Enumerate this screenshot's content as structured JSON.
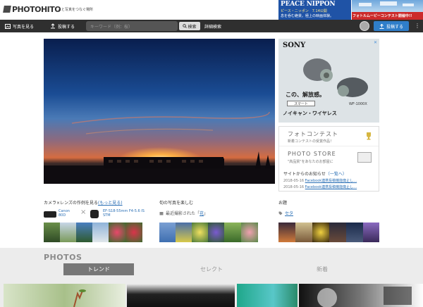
{
  "brand": {
    "logo_text": "PHOTOHITO",
    "tagline": "人と写真をつなぐ場所"
  },
  "ads": {
    "peace": {
      "title": "PEACE NIPPON",
      "line1": "ピース・ニッポン　7.14公開",
      "line2": "息を呑む絶景。極上の映画体験。"
    },
    "photo_contest": {
      "text": "フォトルムービーコンテスト開催中!!"
    },
    "sony": {
      "brand": "SONY",
      "close": "✕",
      "copy1": "この、解放感。",
      "smart_label": "スマート",
      "model": "WF-1000X",
      "copy2": "ノイキャン・ワイヤレス"
    }
  },
  "nav": {
    "browse_label": "写真を見る",
    "post_label": "投稿する",
    "search_placeholder": "キーワード（例：桜）",
    "search_button": "検索",
    "advanced_search": "詳細検索",
    "post_button": "投稿する",
    "more": "⋮"
  },
  "sidebar": {
    "contest_title": "フォトコンテスト",
    "contest_sub": "新着コンテストの受賞作品！",
    "store_title": "PHOTO STORE",
    "store_sub": "\"高品質\"をあなたのお部屋に",
    "news_head": "サイトからのお知らせ",
    "news_list_link": "（一覧へ）",
    "news": [
      {
        "date": "2018-05-16",
        "text": "Facebook連携投稿機能廃止し…"
      },
      {
        "date": "2018-05-16",
        "text": "Facebook連携投稿機能廃止し…"
      }
    ]
  },
  "features": {
    "camera": {
      "title": "カメラ×レンズの作例を見る",
      "more_link": "(もっと見る)",
      "camera_name_1": "Canon",
      "camera_name_2": "80D",
      "cross": "×",
      "lens_name_1": "EF-S18-55mm F4-5.6 IS",
      "lens_name_2": "STM"
    },
    "season": {
      "title": "旬の写真を楽しむ",
      "sub_prefix": "最近撮影された「",
      "sub_link": "花",
      "sub_suffix": "」"
    },
    "theme": {
      "title": "お題",
      "tag": "セタ"
    }
  },
  "photos": {
    "section_title": "PHOTOS",
    "tabs": [
      {
        "label": "トレンド",
        "active": true
      },
      {
        "label": "セレクト",
        "active": false
      },
      {
        "label": "新着",
        "active": false
      }
    ]
  },
  "colors": {
    "nav_bg": "#2f2f2f",
    "accent_blue": "#2f7ec9",
    "link_blue": "#2a6fb5"
  }
}
